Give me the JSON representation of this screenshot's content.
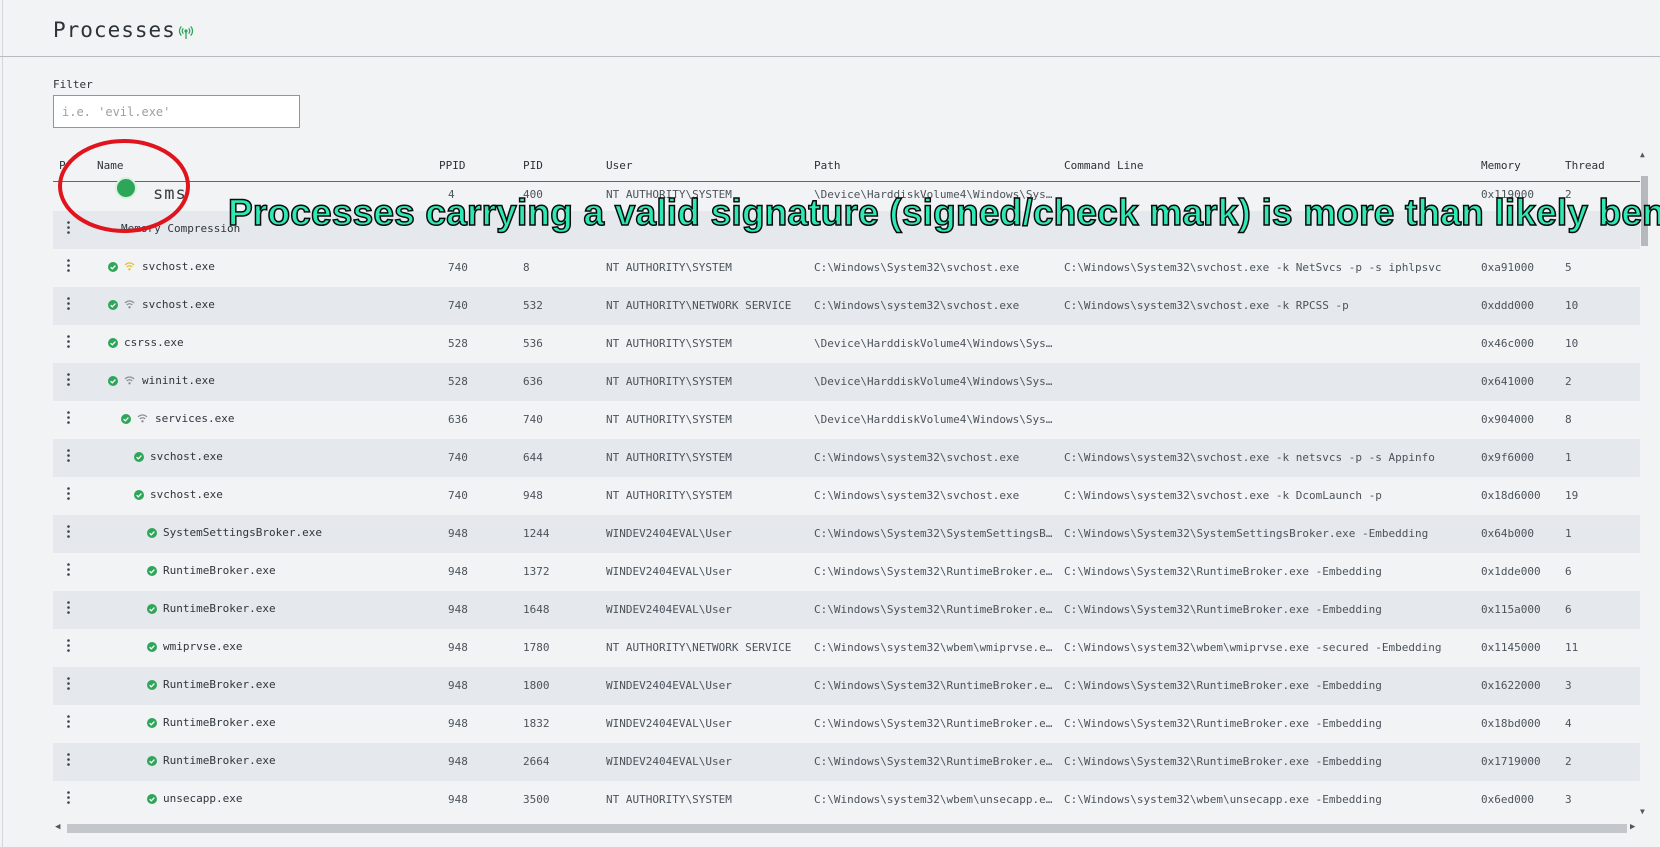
{
  "page": {
    "title": "Processes",
    "filter_label": "Filter",
    "filter_placeholder": "i.e. 'evil.exe'",
    "filter_value": ""
  },
  "columns": {
    "pid_short": "P",
    "name": "Name",
    "ppid": "PPID",
    "pid": "PID",
    "user": "User",
    "path": "Path",
    "cmdline": "Command Line",
    "memory": "Memory",
    "thread": "Thread"
  },
  "rows": [
    {
      "name": "sms",
      "ppid": "4",
      "pid": "400",
      "user": "NT AUTHORITY\\SYSTEM",
      "path": "\\Device\\HarddiskVolume4\\Windows\\Sys…",
      "cmd": "",
      "memory": "0x119000",
      "thread": "2",
      "net": "none",
      "indent": 0
    },
    {
      "name": "Memory Compression",
      "ppid": "",
      "pid": "",
      "user": "",
      "path": "",
      "cmd": "",
      "memory": "",
      "thread": "",
      "net": "none",
      "indent": 0
    },
    {
      "name": "svchost.exe",
      "ppid": "740",
      "pid": "8",
      "user": "NT AUTHORITY\\SYSTEM",
      "path": "C:\\Windows\\System32\\svchost.exe",
      "cmd": "C:\\Windows\\System32\\svchost.exe -k NetSvcs -p -s iphlpsvc",
      "memory": "0xa91000",
      "thread": "5",
      "net": "yellow",
      "indent": 0
    },
    {
      "name": "svchost.exe",
      "ppid": "740",
      "pid": "532",
      "user": "NT AUTHORITY\\NETWORK SERVICE",
      "path": "C:\\Windows\\system32\\svchost.exe",
      "cmd": "C:\\Windows\\system32\\svchost.exe -k RPCSS -p",
      "memory": "0xddd000",
      "thread": "10",
      "net": "gray",
      "indent": 0
    },
    {
      "name": "csrss.exe",
      "ppid": "528",
      "pid": "536",
      "user": "NT AUTHORITY\\SYSTEM",
      "path": "\\Device\\HarddiskVolume4\\Windows\\Sys…",
      "cmd": "",
      "memory": "0x46c000",
      "thread": "10",
      "net": "none",
      "indent": 0
    },
    {
      "name": "wininit.exe",
      "ppid": "528",
      "pid": "636",
      "user": "NT AUTHORITY\\SYSTEM",
      "path": "\\Device\\HarddiskVolume4\\Windows\\Sys…",
      "cmd": "",
      "memory": "0x641000",
      "thread": "2",
      "net": "gray",
      "indent": 0
    },
    {
      "name": "services.exe",
      "ppid": "636",
      "pid": "740",
      "user": "NT AUTHORITY\\SYSTEM",
      "path": "\\Device\\HarddiskVolume4\\Windows\\Sys…",
      "cmd": "",
      "memory": "0x904000",
      "thread": "8",
      "net": "gray",
      "indent": 1
    },
    {
      "name": "svchost.exe",
      "ppid": "740",
      "pid": "644",
      "user": "NT AUTHORITY\\SYSTEM",
      "path": "C:\\Windows\\system32\\svchost.exe",
      "cmd": "C:\\Windows\\system32\\svchost.exe -k netsvcs -p -s Appinfo",
      "memory": "0x9f6000",
      "thread": "1",
      "net": "none",
      "indent": 2
    },
    {
      "name": "svchost.exe",
      "ppid": "740",
      "pid": "948",
      "user": "NT AUTHORITY\\SYSTEM",
      "path": "C:\\Windows\\system32\\svchost.exe",
      "cmd": "C:\\Windows\\system32\\svchost.exe -k DcomLaunch -p",
      "memory": "0x18d6000",
      "thread": "19",
      "net": "none",
      "indent": 2
    },
    {
      "name": "SystemSettingsBroker.exe",
      "ppid": "948",
      "pid": "1244",
      "user": "WINDEV2404EVAL\\User",
      "path": "C:\\Windows\\System32\\SystemSettingsB…",
      "cmd": "C:\\Windows\\System32\\SystemSettingsBroker.exe -Embedding",
      "memory": "0x64b000",
      "thread": "1",
      "net": "none",
      "indent": 3
    },
    {
      "name": "RuntimeBroker.exe",
      "ppid": "948",
      "pid": "1372",
      "user": "WINDEV2404EVAL\\User",
      "path": "C:\\Windows\\System32\\RuntimeBroker.e…",
      "cmd": "C:\\Windows\\System32\\RuntimeBroker.exe -Embedding",
      "memory": "0x1dde000",
      "thread": "6",
      "net": "none",
      "indent": 3
    },
    {
      "name": "RuntimeBroker.exe",
      "ppid": "948",
      "pid": "1648",
      "user": "WINDEV2404EVAL\\User",
      "path": "C:\\Windows\\System32\\RuntimeBroker.e…",
      "cmd": "C:\\Windows\\System32\\RuntimeBroker.exe -Embedding",
      "memory": "0x115a000",
      "thread": "6",
      "net": "none",
      "indent": 3
    },
    {
      "name": "wmiprvse.exe",
      "ppid": "948",
      "pid": "1780",
      "user": "NT AUTHORITY\\NETWORK SERVICE",
      "path": "C:\\Windows\\system32\\wbem\\wmiprvse.e…",
      "cmd": "C:\\Windows\\system32\\wbem\\wmiprvse.exe -secured -Embedding",
      "memory": "0x1145000",
      "thread": "11",
      "net": "none",
      "indent": 3
    },
    {
      "name": "RuntimeBroker.exe",
      "ppid": "948",
      "pid": "1800",
      "user": "WINDEV2404EVAL\\User",
      "path": "C:\\Windows\\System32\\RuntimeBroker.e…",
      "cmd": "C:\\Windows\\System32\\RuntimeBroker.exe -Embedding",
      "memory": "0x1622000",
      "thread": "3",
      "net": "none",
      "indent": 3
    },
    {
      "name": "RuntimeBroker.exe",
      "ppid": "948",
      "pid": "1832",
      "user": "WINDEV2404EVAL\\User",
      "path": "C:\\Windows\\System32\\RuntimeBroker.e…",
      "cmd": "C:\\Windows\\System32\\RuntimeBroker.exe -Embedding",
      "memory": "0x18bd000",
      "thread": "4",
      "net": "none",
      "indent": 3
    },
    {
      "name": "RuntimeBroker.exe",
      "ppid": "948",
      "pid": "2664",
      "user": "WINDEV2404EVAL\\User",
      "path": "C:\\Windows\\System32\\RuntimeBroker.e…",
      "cmd": "C:\\Windows\\System32\\RuntimeBroker.exe -Embedding",
      "memory": "0x1719000",
      "thread": "2",
      "net": "none",
      "indent": 3
    },
    {
      "name": "unsecapp.exe",
      "ppid": "948",
      "pid": "3500",
      "user": "NT AUTHORITY\\SYSTEM",
      "path": "C:\\Windows\\system32\\wbem\\unsecapp.e…",
      "cmd": "C:\\Windows\\system32\\wbem\\unsecapp.exe -Embedding",
      "memory": "0x6ed000",
      "thread": "3",
      "net": "none",
      "indent": 3
    }
  ],
  "annotation": {
    "text": "Processes carrying a valid signature (signed/check mark) is more than likely benign",
    "zoomed_name": "sms"
  },
  "colors": {
    "signed_check": "#2ea65a",
    "net_active": "#e6c21a",
    "net_idle": "#8a9097",
    "annotation_fill": "#2fe8b4",
    "annotation_circle": "#e0141c"
  }
}
